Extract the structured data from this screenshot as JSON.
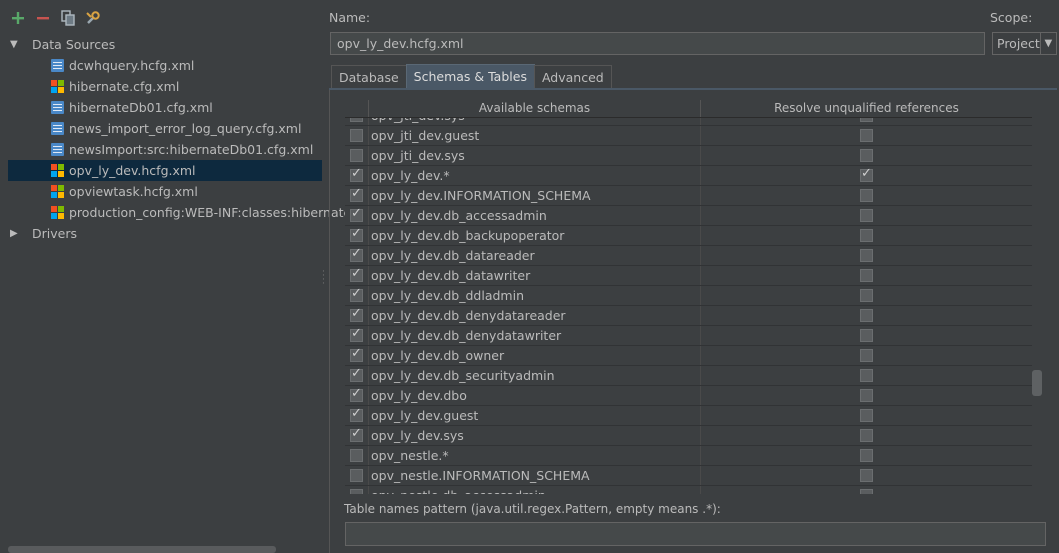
{
  "toolbar": {
    "buttons": [
      {
        "name": "add-icon",
        "glyph": "+",
        "color": "#59a869"
      },
      {
        "name": "remove-icon",
        "glyph": "−",
        "color": "#c75450"
      },
      {
        "name": "copy-icon",
        "glyph": "copy"
      },
      {
        "name": "settings-icon",
        "glyph": "wrench"
      }
    ]
  },
  "tree": {
    "data_sources_label": "Data Sources",
    "drivers_label": "Drivers",
    "files": [
      {
        "label": "dcwhquery.hcfg.xml",
        "icon": "cfg-icon"
      },
      {
        "label": "hibernate.cfg.xml",
        "icon": "ms-icon"
      },
      {
        "label": "hibernateDb01.cfg.xml",
        "icon": "cfg-icon"
      },
      {
        "label": "news_import_error_log_query.cfg.xml",
        "icon": "cfg-icon"
      },
      {
        "label": "newsImport:src:hibernateDb01.cfg.xml",
        "icon": "cfg-icon"
      },
      {
        "label": "opv_ly_dev.hcfg.xml",
        "icon": "ms-icon",
        "selected": true
      },
      {
        "label": "opviewtask.hcfg.xml",
        "icon": "ms-icon"
      },
      {
        "label": "production_config:WEB-INF:classes:hibernate",
        "icon": "ms-icon"
      }
    ]
  },
  "form": {
    "name_label": "Name:",
    "name_value": "opv_ly_dev.hcfg.xml",
    "scope_label": "Scope:",
    "scope_value": "Project"
  },
  "tabs": [
    {
      "label": "Database",
      "active": false
    },
    {
      "label": "Schemas & Tables",
      "active": true
    },
    {
      "label": "Advanced",
      "active": false
    }
  ],
  "schemas_table": {
    "col_available": "Available schemas",
    "col_resolve": "Resolve unqualified references",
    "rows": [
      {
        "name": "opv_jti_dev.sys",
        "checked": false,
        "resolve": false
      },
      {
        "name": "opv_jti_dev.guest",
        "checked": false,
        "resolve": false
      },
      {
        "name": "opv_jti_dev.sys",
        "checked": false,
        "resolve": false
      },
      {
        "name": "opv_ly_dev.*",
        "checked": true,
        "resolve": true
      },
      {
        "name": "opv_ly_dev.INFORMATION_SCHEMA",
        "checked": true,
        "resolve": false
      },
      {
        "name": "opv_ly_dev.db_accessadmin",
        "checked": true,
        "resolve": false
      },
      {
        "name": "opv_ly_dev.db_backupoperator",
        "checked": true,
        "resolve": false
      },
      {
        "name": "opv_ly_dev.db_datareader",
        "checked": true,
        "resolve": false
      },
      {
        "name": "opv_ly_dev.db_datawriter",
        "checked": true,
        "resolve": false
      },
      {
        "name": "opv_ly_dev.db_ddladmin",
        "checked": true,
        "resolve": false
      },
      {
        "name": "opv_ly_dev.db_denydatareader",
        "checked": true,
        "resolve": false
      },
      {
        "name": "opv_ly_dev.db_denydatawriter",
        "checked": true,
        "resolve": false
      },
      {
        "name": "opv_ly_dev.db_owner",
        "checked": true,
        "resolve": false
      },
      {
        "name": "opv_ly_dev.db_securityadmin",
        "checked": true,
        "resolve": false
      },
      {
        "name": "opv_ly_dev.dbo",
        "checked": true,
        "resolve": false
      },
      {
        "name": "opv_ly_dev.guest",
        "checked": true,
        "resolve": false
      },
      {
        "name": "opv_ly_dev.sys",
        "checked": true,
        "resolve": false
      },
      {
        "name": "opv_nestle.*",
        "checked": false,
        "resolve": false
      },
      {
        "name": "opv_nestle.INFORMATION_SCHEMA",
        "checked": false,
        "resolve": false
      },
      {
        "name": "opv_nestle.db_accessadmin",
        "checked": false,
        "resolve": false
      }
    ]
  },
  "pattern": {
    "label": "Table names pattern (java.util.regex.Pattern, empty means  .*):",
    "value": ""
  }
}
